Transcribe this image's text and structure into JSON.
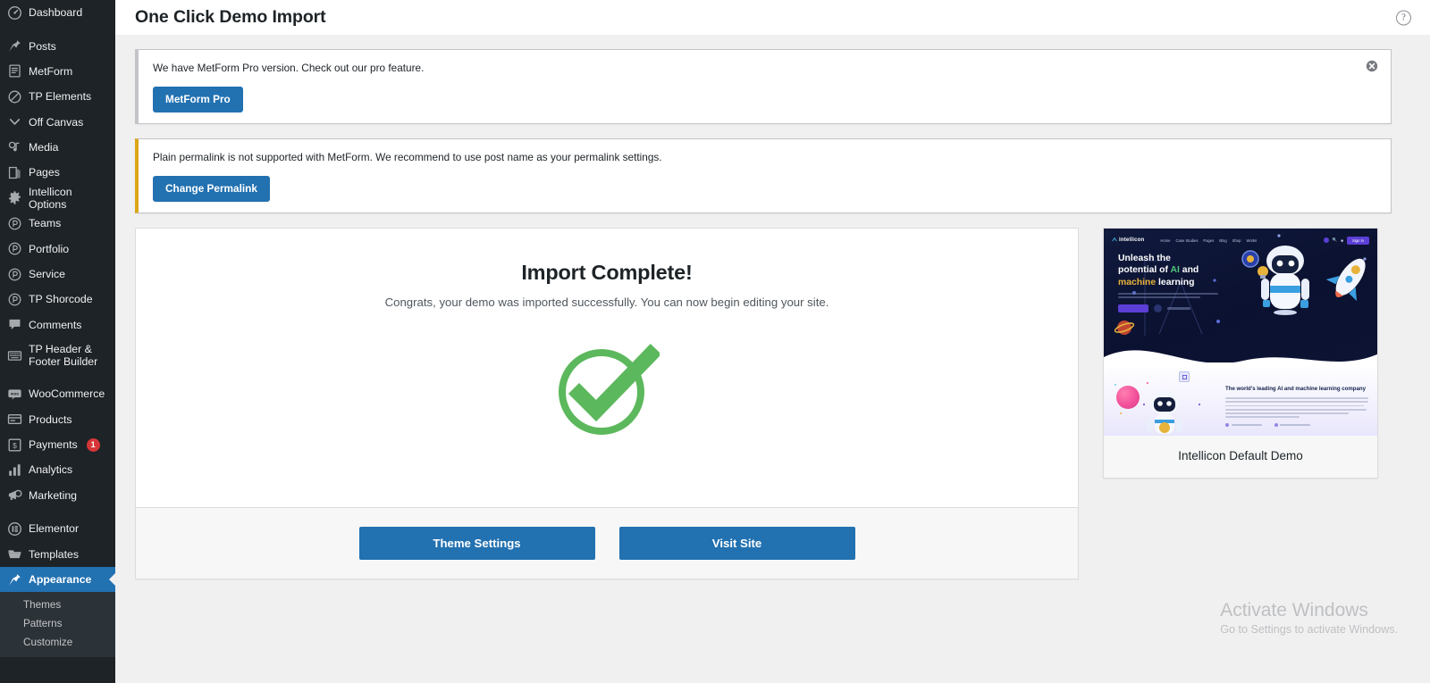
{
  "sidebar": {
    "items": [
      {
        "label": "Dashboard",
        "icon": "dashboard-icon",
        "sep_after": true
      },
      {
        "label": "Posts",
        "icon": "pin-icon"
      },
      {
        "label": "MetForm",
        "icon": "form-icon"
      },
      {
        "label": "TP Elements",
        "icon": "slash-circle-icon"
      },
      {
        "label": "Off Canvas",
        "icon": "chevron-down-icon"
      },
      {
        "label": "Media",
        "icon": "media-icon"
      },
      {
        "label": "Pages",
        "icon": "pages-icon"
      },
      {
        "label": "Intellicon Options",
        "icon": "gear-icon"
      },
      {
        "label": "Teams",
        "icon": "circle-p-icon"
      },
      {
        "label": "Portfolio",
        "icon": "circle-p-icon"
      },
      {
        "label": "Service",
        "icon": "circle-p-icon"
      },
      {
        "label": "TP Shorcode",
        "icon": "circle-p-icon"
      },
      {
        "label": "Comments",
        "icon": "comment-icon"
      },
      {
        "label": "TP Header & Footer Builder",
        "icon": "keyboard-icon",
        "two_line": true,
        "sep_after": true
      },
      {
        "label": "WooCommerce",
        "icon": "woo-icon"
      },
      {
        "label": "Products",
        "icon": "products-icon"
      },
      {
        "label": "Payments",
        "icon": "payments-icon",
        "badge": "1"
      },
      {
        "label": "Analytics",
        "icon": "analytics-icon"
      },
      {
        "label": "Marketing",
        "icon": "megaphone-icon",
        "sep_after": true
      },
      {
        "label": "Elementor",
        "icon": "elementor-icon"
      },
      {
        "label": "Templates",
        "icon": "folder-icon"
      },
      {
        "label": "Appearance",
        "icon": "appearance-pin-icon",
        "current": true
      }
    ],
    "submenu": [
      {
        "label": "Themes"
      },
      {
        "label": "Patterns"
      },
      {
        "label": "Customize"
      }
    ]
  },
  "header": {
    "title": "One Click Demo Import",
    "help_tab_label": "?"
  },
  "notices": [
    {
      "style": "gray",
      "text": "We have MetForm Pro version. Check out our pro feature.",
      "button": "MetForm Pro",
      "dismissible": true
    },
    {
      "style": "warn",
      "text": "Plain permalink is not supported with MetForm. We recommend to use post name as your permalink settings.",
      "button": "Change Permalink",
      "dismissible": false
    }
  ],
  "import_card": {
    "title": "Import Complete!",
    "subtitle": "Congrats, your demo was imported successfully. You can now begin editing your site.",
    "status_icon": "green-check-circle-icon",
    "status_color": "#5cb85c",
    "buttons": [
      {
        "label": "Theme Settings",
        "name": "theme-settings-button"
      },
      {
        "label": "Visit Site",
        "name": "visit-site-button"
      }
    ]
  },
  "demo_preview": {
    "caption": "Intellicon Default Demo",
    "thumbnail": {
      "logo": "intellicon",
      "nav_links": [
        "Home",
        "Case Studies",
        "Pages",
        "Blog",
        "Shop",
        "Works"
      ],
      "nav_cta": "Sign In",
      "hero_line1": "Unleash the",
      "hero_line2_pre": "potential of ",
      "hero_line2_accent": "AI",
      "hero_line2_post": " and",
      "hero_line3_accent": "machine",
      "hero_line3_post": " learning",
      "hero_paragraph": "Machine learning algorithms build a model based on sample data, known as training data, in order to make predictions or decisions...",
      "hero_button": "Get Started",
      "hero_video_label": "Watch Intro Video",
      "section_heading": "The world's leading AI and machine learning company",
      "section_paragraph": "There are many variations of passages of Lorem Ipsum available, but the majority have suffered alteration in some form, by injected humour, or randomised words which don't look even slightly believable. If you are going to use a passage of Lorem Ipsum, you need to be sure there isn't anything embarrassing hidden in the middle of text.",
      "features": [
        "Better Advisory Team",
        "100% Security System"
      ],
      "accent_green": "#4cc47c",
      "accent_gold": "#e8b33a",
      "accent_purple": "#5b3fd6",
      "hero_bg": "#0b1130"
    }
  },
  "watermark": {
    "line1": "Activate Windows",
    "line2": "Go to Settings to activate Windows."
  }
}
